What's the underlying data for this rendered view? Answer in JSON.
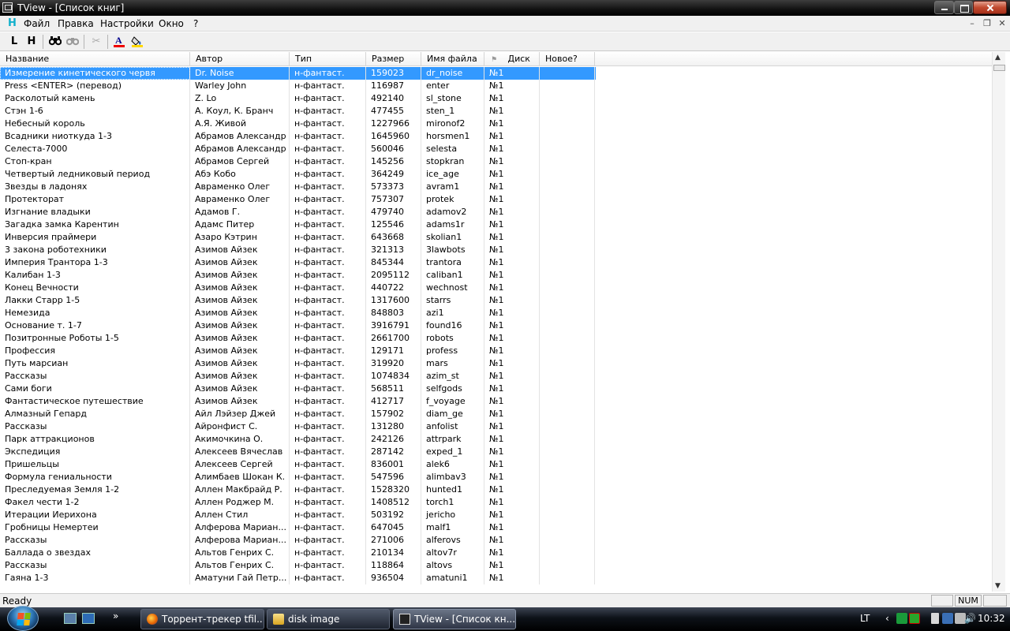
{
  "window": {
    "title": "TView - [Список книг]"
  },
  "menu": {
    "items": [
      "Файл",
      "Правка",
      "Настройки",
      "Окно",
      "?"
    ]
  },
  "toolbar": {
    "buttons": [
      "L",
      "H"
    ]
  },
  "table": {
    "columns": [
      "Название",
      "Автор",
      "Тип",
      "Размер",
      "Имя файла",
      "Диск",
      "Новое?"
    ],
    "rows": [
      [
        "Измерение кинетического червя",
        "Dr. Noise",
        "н-фантаст.",
        "159023",
        "dr_noise",
        "№1",
        ""
      ],
      [
        "Press <ENTER> (перевод)",
        "Warley John",
        "н-фантаст.",
        "116987",
        "enter",
        "№1",
        ""
      ],
      [
        "Расколотый камень",
        "Z. Lo",
        "н-фантаст.",
        "492140",
        "sl_stone",
        "№1",
        ""
      ],
      [
        "Стэн 1-6",
        "А. Коул, К. Бранч",
        "н-фантаст.",
        "477455",
        "sten_1",
        "№1",
        ""
      ],
      [
        "Небесный король",
        "А.Я. Живой",
        "н-фантаст.",
        "1227966",
        "mironof2",
        "№1",
        ""
      ],
      [
        "Всадники ниоткуда 1-3",
        "Абрамов Александр",
        "н-фантаст.",
        "1645960",
        "horsmen1",
        "№1",
        ""
      ],
      [
        "Селеста-7000",
        "Абрамов Александр",
        "н-фантаст.",
        "560046",
        "selesta",
        "№1",
        ""
      ],
      [
        "Стоп-кран",
        "Абрамов Сергей",
        "н-фантаст.",
        "145256",
        "stopkran",
        "№1",
        ""
      ],
      [
        "Четвертый ледниковый период",
        "Абэ Кобо",
        "н-фантаст.",
        "364249",
        "ice_age",
        "№1",
        ""
      ],
      [
        "Звезды в ладонях",
        "Авраменко Олег",
        "н-фантаст.",
        "573373",
        "avram1",
        "№1",
        ""
      ],
      [
        "Протекторат",
        "Авраменко Олег",
        "н-фантаст.",
        "757307",
        "protek",
        "№1",
        ""
      ],
      [
        "Изгнание владыки",
        "Адамов Г.",
        "н-фантаст.",
        "479740",
        "adamov2",
        "№1",
        ""
      ],
      [
        "Загадка замка Карентин",
        "Адамс Питер",
        "н-фантаст.",
        "125546",
        "adams1r",
        "№1",
        ""
      ],
      [
        "Инверсия праймери",
        "Азаро Кэтрин",
        "н-фантаст.",
        "643668",
        "skolian1",
        "№1",
        ""
      ],
      [
        "3 закона роботехники",
        "Азимов Айзек",
        "н-фантаст.",
        "321313",
        "3lawbots",
        "№1",
        ""
      ],
      [
        "Империя Трантора 1-3",
        "Азимов Айзек",
        "н-фантаст.",
        "845344",
        "trantora",
        "№1",
        ""
      ],
      [
        "Калибан 1-3",
        "Азимов Айзек",
        "н-фантаст.",
        "2095112",
        "caliban1",
        "№1",
        ""
      ],
      [
        "Конец Вечности",
        "Азимов Айзек",
        "н-фантаст.",
        "440722",
        "wechnost",
        "№1",
        ""
      ],
      [
        "Лакки Старр 1-5",
        "Азимов Айзек",
        "н-фантаст.",
        "1317600",
        "starrs",
        "№1",
        ""
      ],
      [
        "Немезида",
        "Азимов Айзек",
        "н-фантаст.",
        "848803",
        "azi1",
        "№1",
        ""
      ],
      [
        "Основание т. 1-7",
        "Азимов Айзек",
        "н-фантаст.",
        "3916791",
        "found16",
        "№1",
        ""
      ],
      [
        "Позитронные Роботы 1-5",
        "Азимов Айзек",
        "н-фантаст.",
        "2661700",
        "robots",
        "№1",
        ""
      ],
      [
        "Профессия",
        "Азимов Айзек",
        "н-фантаст.",
        "129171",
        "profess",
        "№1",
        ""
      ],
      [
        "Путь марсиан",
        "Азимов Айзек",
        "н-фантаст.",
        "319920",
        "mars",
        "№1",
        ""
      ],
      [
        "Рассказы",
        "Азимов Айзек",
        "н-фантаст.",
        "1074834",
        "azim_st",
        "№1",
        ""
      ],
      [
        "Сами боги",
        "Азимов Айзек",
        "н-фантаст.",
        "568511",
        "selfgods",
        "№1",
        ""
      ],
      [
        "Фантастическое путешествие",
        "Азимов Айзек",
        "н-фантаст.",
        "412717",
        "f_voyage",
        "№1",
        ""
      ],
      [
        "Алмазный Гепард",
        "Айл Лэйзер Джей",
        "н-фантаст.",
        "157902",
        "diam_ge",
        "№1",
        ""
      ],
      [
        "Рассказы",
        "Айронфист С.",
        "н-фантаст.",
        "131280",
        "anfolist",
        "№1",
        ""
      ],
      [
        "Парк аттракционов",
        "Акимочкина О.",
        "н-фантаст.",
        "242126",
        "attrpark",
        "№1",
        ""
      ],
      [
        "Экспедиция",
        "Алексеев Вячеслав",
        "н-фантаст.",
        "287142",
        "exped_1",
        "№1",
        ""
      ],
      [
        "Пришельцы",
        "Алексеев Сергей",
        "н-фантаст.",
        "836001",
        "alek6",
        "№1",
        ""
      ],
      [
        "Формула гениальности",
        "Алимбаев Шокан К.",
        "н-фантаст.",
        "547596",
        "alimbav3",
        "№1",
        ""
      ],
      [
        "Преследуемая Земля 1-2",
        "Аллен Макбрайд Р.",
        "н-фантаст.",
        "1528320",
        "hunted1",
        "№1",
        ""
      ],
      [
        "Факел чести 1-2",
        "Аллен Роджер М.",
        "н-фантаст.",
        "1408512",
        "torch1",
        "№1",
        ""
      ],
      [
        "Итерации Иерихона",
        "Аллен Стил",
        "н-фантаст.",
        "503192",
        "jericho",
        "№1",
        ""
      ],
      [
        "Гробницы Немертеи",
        "Алферова Мариан...",
        "н-фантаст.",
        "647045",
        "malf1",
        "№1",
        ""
      ],
      [
        "Рассказы",
        "Алферова Мариан...",
        "н-фантаст.",
        "271006",
        "alferovs",
        "№1",
        ""
      ],
      [
        "Баллада о звездах",
        "Альтов Генрих С.",
        "н-фантаст.",
        "210134",
        "altov7r",
        "№1",
        ""
      ],
      [
        "Рассказы",
        "Альтов Генрих С.",
        "н-фантаст.",
        "118864",
        "altovs",
        "№1",
        ""
      ],
      [
        "Гаяна 1-3",
        "Аматуни Гай Петр...",
        "н-фантаст.",
        "936504",
        "amatuni1",
        "№1",
        ""
      ]
    ],
    "selected_row_index": 0
  },
  "status": {
    "text": "Ready",
    "num_indicator": "NUM"
  },
  "taskbar": {
    "tasks": [
      "Торрент-трекер tfil...",
      "disk image",
      "TView - [Список кн..."
    ],
    "language": "LT",
    "clock": "10:32"
  }
}
